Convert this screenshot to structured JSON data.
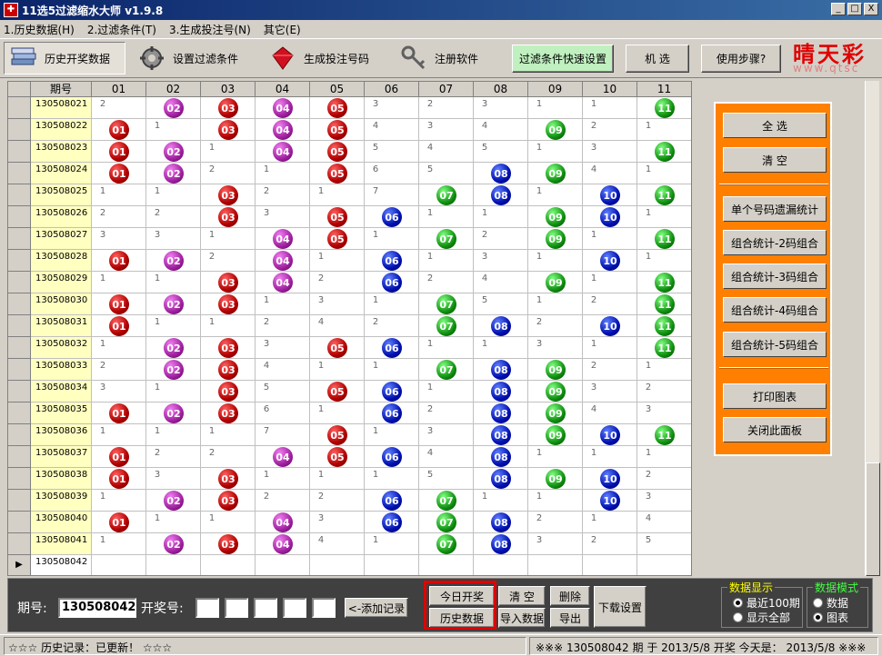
{
  "window": {
    "title": "11选5过滤缩水大师  v1.9.8",
    "min": "_",
    "max": "□",
    "close": "X"
  },
  "menu": [
    "1.历史数据(H)",
    "2.过滤条件(T)",
    "3.生成投注号(N)",
    "其它(E)"
  ],
  "toolbar": {
    "history": "历史开奖数据",
    "filter": "设置过滤条件",
    "generate": "生成投注号码",
    "register": "注册软件",
    "quick": "过滤条件快速设置",
    "random": "机 选",
    "steps": "使用步骤?"
  },
  "brand": {
    "text": "晴天彩",
    "url": "www.qtsc"
  },
  "grid": {
    "period_header": "期号",
    "columns": [
      "01",
      "02",
      "03",
      "04",
      "05",
      "06",
      "07",
      "08",
      "09",
      "10",
      "11"
    ],
    "rows": [
      {
        "period": "130508021",
        "cells": [
          "2",
          "02",
          "03",
          "04",
          "05",
          "3",
          "2",
          "3",
          "1",
          "1",
          "11"
        ]
      },
      {
        "period": "130508022",
        "cells": [
          "01",
          "1",
          "03",
          "04",
          "05",
          "4",
          "3",
          "4",
          "09",
          "2",
          "1"
        ]
      },
      {
        "period": "130508023",
        "cells": [
          "01",
          "02",
          "1",
          "04",
          "05",
          "5",
          "4",
          "5",
          "1",
          "3",
          "11"
        ]
      },
      {
        "period": "130508024",
        "cells": [
          "01",
          "02",
          "2",
          "1",
          "05",
          "6",
          "5",
          "08",
          "09",
          "4",
          "1"
        ]
      },
      {
        "period": "130508025",
        "cells": [
          "1",
          "1",
          "03",
          "2",
          "1",
          "7",
          "07",
          "08",
          "1",
          "10",
          "11"
        ]
      },
      {
        "period": "130508026",
        "cells": [
          "2",
          "2",
          "03",
          "3",
          "05",
          "06",
          "1",
          "1",
          "09",
          "10",
          "1"
        ]
      },
      {
        "period": "130508027",
        "cells": [
          "3",
          "3",
          "1",
          "04",
          "05",
          "1",
          "07",
          "2",
          "09",
          "1",
          "11"
        ]
      },
      {
        "period": "130508028",
        "cells": [
          "01",
          "02",
          "2",
          "04",
          "1",
          "06",
          "1",
          "3",
          "1",
          "10",
          "1"
        ]
      },
      {
        "period": "130508029",
        "cells": [
          "1",
          "1",
          "03",
          "04",
          "2",
          "06",
          "2",
          "4",
          "09",
          "1",
          "11"
        ]
      },
      {
        "period": "130508030",
        "cells": [
          "01",
          "02",
          "03",
          "1",
          "3",
          "1",
          "07",
          "5",
          "1",
          "2",
          "11"
        ]
      },
      {
        "period": "130508031",
        "cells": [
          "01",
          "1",
          "1",
          "2",
          "4",
          "2",
          "07",
          "08",
          "2",
          "10",
          "11"
        ]
      },
      {
        "period": "130508032",
        "cells": [
          "1",
          "02",
          "03",
          "3",
          "05",
          "06",
          "1",
          "1",
          "3",
          "1",
          "11"
        ]
      },
      {
        "period": "130508033",
        "cells": [
          "2",
          "02",
          "03",
          "4",
          "1",
          "1",
          "07",
          "08",
          "09",
          "2",
          "1"
        ]
      },
      {
        "period": "130508034",
        "cells": [
          "3",
          "1",
          "03",
          "5",
          "05",
          "06",
          "1",
          "08",
          "09",
          "3",
          "2"
        ]
      },
      {
        "period": "130508035",
        "cells": [
          "01",
          "02",
          "03",
          "6",
          "1",
          "06",
          "2",
          "08",
          "09",
          "4",
          "3"
        ]
      },
      {
        "period": "130508036",
        "cells": [
          "1",
          "1",
          "1",
          "7",
          "05",
          "1",
          "3",
          "08",
          "09",
          "10",
          "11"
        ]
      },
      {
        "period": "130508037",
        "cells": [
          "01",
          "2",
          "2",
          "04",
          "05",
          "06",
          "4",
          "08",
          "1",
          "1",
          "1"
        ]
      },
      {
        "period": "130508038",
        "cells": [
          "01",
          "3",
          "03",
          "1",
          "1",
          "1",
          "5",
          "08",
          "09",
          "10",
          "2"
        ]
      },
      {
        "period": "130508039",
        "cells": [
          "1",
          "02",
          "03",
          "2",
          "2",
          "06",
          "07",
          "1",
          "1",
          "10",
          "3"
        ]
      },
      {
        "period": "130508040",
        "cells": [
          "01",
          "1",
          "1",
          "04",
          "3",
          "06",
          "07",
          "08",
          "2",
          "1",
          "4"
        ]
      },
      {
        "period": "130508041",
        "cells": [
          "1",
          "02",
          "03",
          "04",
          "4",
          "1",
          "07",
          "08",
          "3",
          "2",
          "5"
        ]
      },
      {
        "period": "130508042",
        "cells": [
          "",
          "",
          "",
          "",
          "",
          "",
          "",
          "",
          "",
          "",
          ""
        ]
      }
    ]
  },
  "ball_colors": {
    "01": "red",
    "02": "purple",
    "03": "red",
    "04": "purple",
    "05": "red",
    "06": "blue",
    "07": "green",
    "08": "blue",
    "09": "green",
    "10": "blue",
    "11": "green"
  },
  "panel": {
    "select_all": "全 选",
    "clear": "清 空",
    "single_stat": "单个号码遗漏统计",
    "combo2": "组合统计-2码组合",
    "combo3": "组合统计-3码组合",
    "combo4": "组合统计-4码组合",
    "combo5": "组合统计-5码组合",
    "print": "打印图表",
    "close_panel": "关闭此面板"
  },
  "bottom": {
    "period_label": "期号:",
    "period_value": "130508042",
    "draw_label": "开奖号:",
    "add_record": "<-添加记录",
    "today_draw": "今日开奖",
    "history_data": "历史数据",
    "clear": "清 空",
    "import": "导入数据",
    "delete": "删除",
    "export": "导出",
    "download": "下载设置",
    "display_legend": "数据显示",
    "recent100": "最近100期",
    "show_all": "显示全部",
    "mode_legend": "数据模式",
    "mode_data": "数据",
    "mode_chart": "图表"
  },
  "status": {
    "left": "☆☆☆  历史记录：已更新！ ☆☆☆",
    "right": "※※※  130508042 期 于 2013/5/8 开奖     今天是： 2013/5/8 ※※※"
  }
}
